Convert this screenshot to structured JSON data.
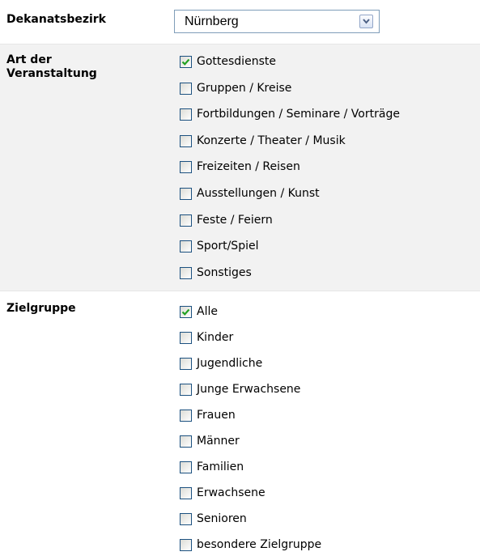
{
  "dekanat": {
    "label": "Dekanatsbezirk",
    "selected": "Nürnberg"
  },
  "art": {
    "label_line1": "Art der",
    "label_line2": "Veranstaltung",
    "options": [
      {
        "label": "Gottesdienste",
        "checked": true
      },
      {
        "label": "Gruppen / Kreise",
        "checked": false
      },
      {
        "label": "Fortbildungen / Seminare / Vorträge",
        "checked": false
      },
      {
        "label": "Konzerte / Theater / Musik",
        "checked": false
      },
      {
        "label": "Freizeiten / Reisen",
        "checked": false
      },
      {
        "label": "Ausstellungen / Kunst",
        "checked": false
      },
      {
        "label": "Feste / Feiern",
        "checked": false
      },
      {
        "label": "Sport/Spiel",
        "checked": false
      },
      {
        "label": "Sonstiges",
        "checked": false
      }
    ]
  },
  "zielgruppe": {
    "label": "Zielgruppe",
    "options": [
      {
        "label": "Alle",
        "checked": true
      },
      {
        "label": "Kinder",
        "checked": false
      },
      {
        "label": "Jugendliche",
        "checked": false
      },
      {
        "label": "Junge Erwachsene",
        "checked": false
      },
      {
        "label": "Frauen",
        "checked": false
      },
      {
        "label": "Männer",
        "checked": false
      },
      {
        "label": "Familien",
        "checked": false
      },
      {
        "label": "Erwachsene",
        "checked": false
      },
      {
        "label": "Senioren",
        "checked": false
      },
      {
        "label": "besondere Zielgruppe",
        "checked": false
      }
    ]
  },
  "colors": {
    "section_alt_bg": "#f2f2f2",
    "check_green": "#21a121",
    "checkbox_border": "#1c5180"
  }
}
